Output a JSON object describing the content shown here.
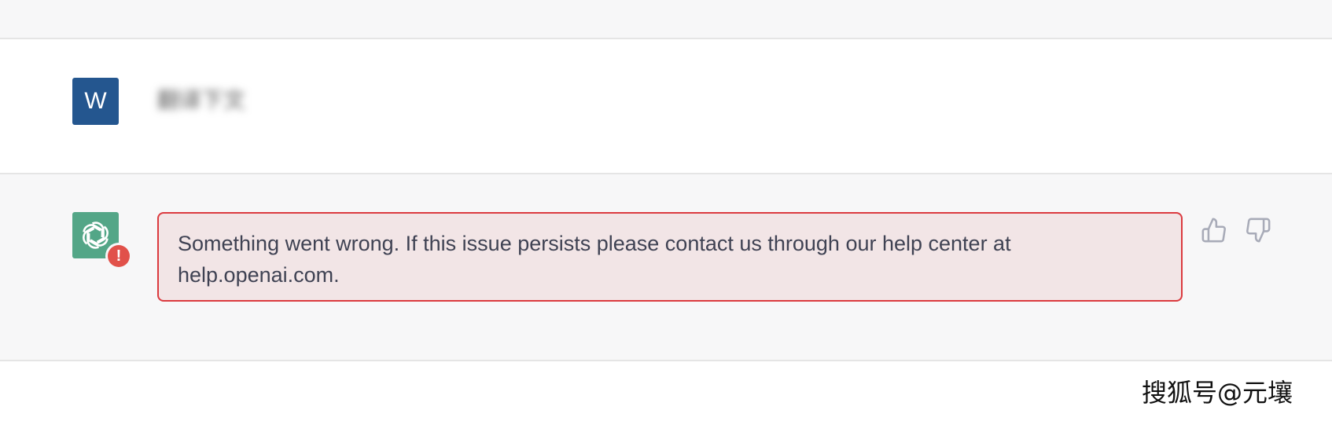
{
  "user_message": {
    "avatar_letter": "W",
    "avatar_color": "#24568f",
    "text": "翻译下文"
  },
  "assistant_message": {
    "avatar_icon": "openai-logo-icon",
    "avatar_color": "#53a687",
    "error_badge": "!",
    "error_text": "Something went wrong. If this issue persists please contact us through our help center at help.openai.com."
  },
  "feedback": {
    "thumbs_up_icon": "thumbs-up-icon",
    "thumbs_down_icon": "thumbs-down-icon"
  },
  "watermark": {
    "text": "搜狐号@元壤"
  },
  "colors": {
    "error_border": "#db3a3f",
    "error_background": "#f2e5e6",
    "error_badge": "#e1514a",
    "row_alt_background": "#f7f7f8"
  }
}
